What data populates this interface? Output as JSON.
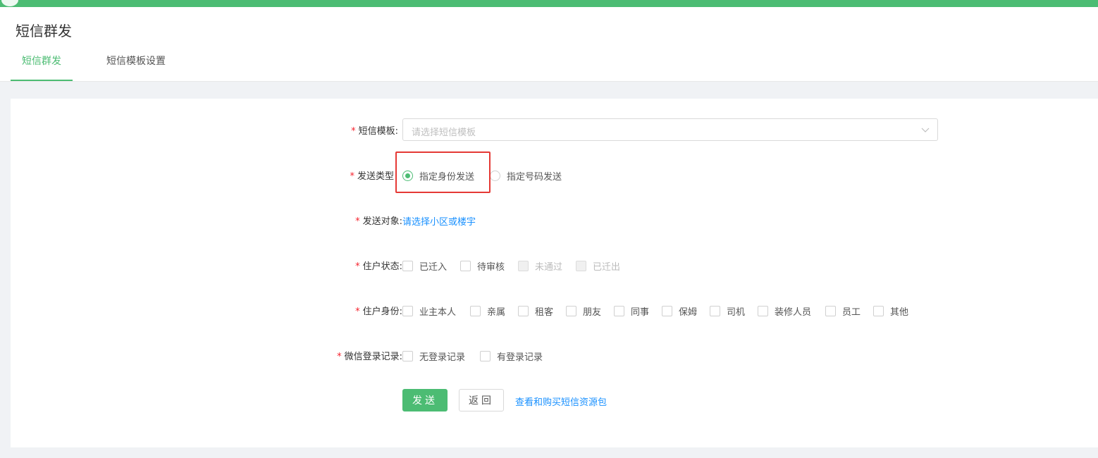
{
  "header": {
    "title": "短信群发",
    "tabs": [
      {
        "label": "短信群发",
        "active": true
      },
      {
        "label": "短信模板设置",
        "active": false
      }
    ]
  },
  "form": {
    "required_mark": "*",
    "template": {
      "label": "短信模板:",
      "placeholder": "请选择短信模板",
      "icon": "chevron-down-icon"
    },
    "send_type": {
      "label": "发送类型",
      "options": [
        {
          "label": "指定身份发送",
          "checked": true
        },
        {
          "label": "指定号码发送",
          "checked": false
        }
      ]
    },
    "target": {
      "label": "发送对象:",
      "link": "请选择小区或楼宇"
    },
    "resident_status": {
      "label": "住户状态:",
      "options": [
        {
          "label": "已迁入",
          "disabled": false
        },
        {
          "label": "待审核",
          "disabled": false
        },
        {
          "label": "未通过",
          "disabled": true
        },
        {
          "label": "已迁出",
          "disabled": true
        }
      ]
    },
    "resident_identity": {
      "label": "住户身份:",
      "options": [
        "业主本人",
        "亲属",
        "租客",
        "朋友",
        "同事",
        "保姆",
        "司机",
        "装修人员",
        "员工",
        "其他"
      ]
    },
    "wechat_login": {
      "label": "微信登录记录:",
      "options": [
        "无登录记录",
        "有登录记录"
      ]
    },
    "actions": {
      "send": "发送",
      "back": "返回",
      "buy_link": "查看和购买短信资源包"
    }
  },
  "colors": {
    "accent": "#4cbc73",
    "link": "#1890ff",
    "required": "#f5222d",
    "highlight": "#e53935"
  }
}
